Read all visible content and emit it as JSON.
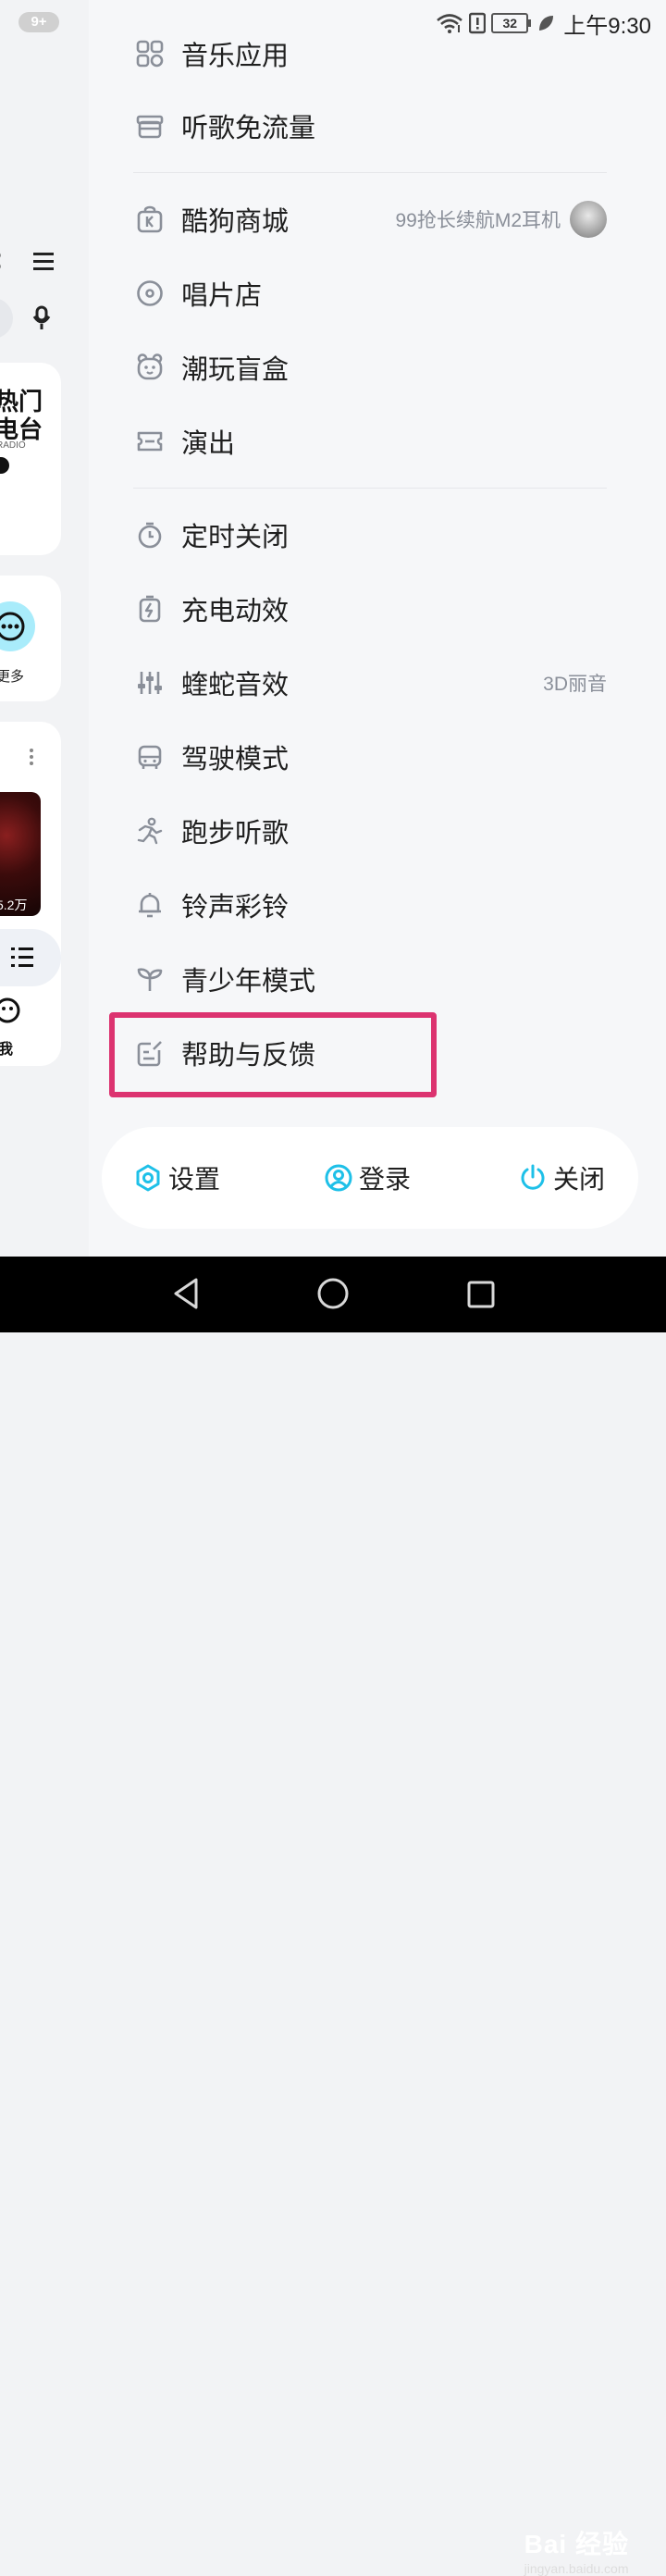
{
  "status_bar": {
    "notification_count": "9+",
    "battery_level": "32",
    "time": "上午9:30",
    "icons": [
      "wifi-icon",
      "alert-icon",
      "battery-icon",
      "leaf-icon"
    ]
  },
  "background_app": {
    "radio_title_line1": "热门",
    "radio_title_line2": "电台",
    "radio_subtitle": "RADIO",
    "more_label": "更多",
    "play_count": "5.2万",
    "me_label": "我"
  },
  "menu": {
    "partial_item_label": "音乐应用",
    "items": [
      {
        "icon": "gift-box-icon",
        "label": "听歌免流量",
        "sub": ""
      },
      {
        "icon": "shopping-bag-icon",
        "label": "酷狗商城",
        "sub": "99抢长续航M2耳机"
      },
      {
        "icon": "vinyl-record-icon",
        "label": "唱片店",
        "sub": ""
      },
      {
        "icon": "bear-face-icon",
        "label": "潮玩盲盒",
        "sub": ""
      },
      {
        "icon": "ticket-icon",
        "label": "演出",
        "sub": ""
      },
      {
        "icon": "timer-icon",
        "label": "定时关闭",
        "sub": ""
      },
      {
        "icon": "charging-battery-icon",
        "label": "充电动效",
        "sub": ""
      },
      {
        "icon": "equalizer-sliders-icon",
        "label": "蝰蛇音效",
        "sub": "3D丽音"
      },
      {
        "icon": "car-icon",
        "label": "驾驶模式",
        "sub": ""
      },
      {
        "icon": "running-person-icon",
        "label": "跑步听歌",
        "sub": ""
      },
      {
        "icon": "bell-icon",
        "label": "铃声彩铃",
        "sub": ""
      },
      {
        "icon": "sprout-icon",
        "label": "青少年模式",
        "sub": ""
      },
      {
        "icon": "feedback-edit-icon",
        "label": "帮助与反馈",
        "sub": ""
      }
    ]
  },
  "footer": {
    "settings_label": "设置",
    "login_label": "登录",
    "close_label": "关闭"
  },
  "watermark": {
    "brand": "Bai 经验",
    "url": "jingyan.baidu.com"
  },
  "colors": {
    "accent": "#1ec0e8",
    "highlight": "#dc3370",
    "icon_gray": "#8a8f99"
  }
}
